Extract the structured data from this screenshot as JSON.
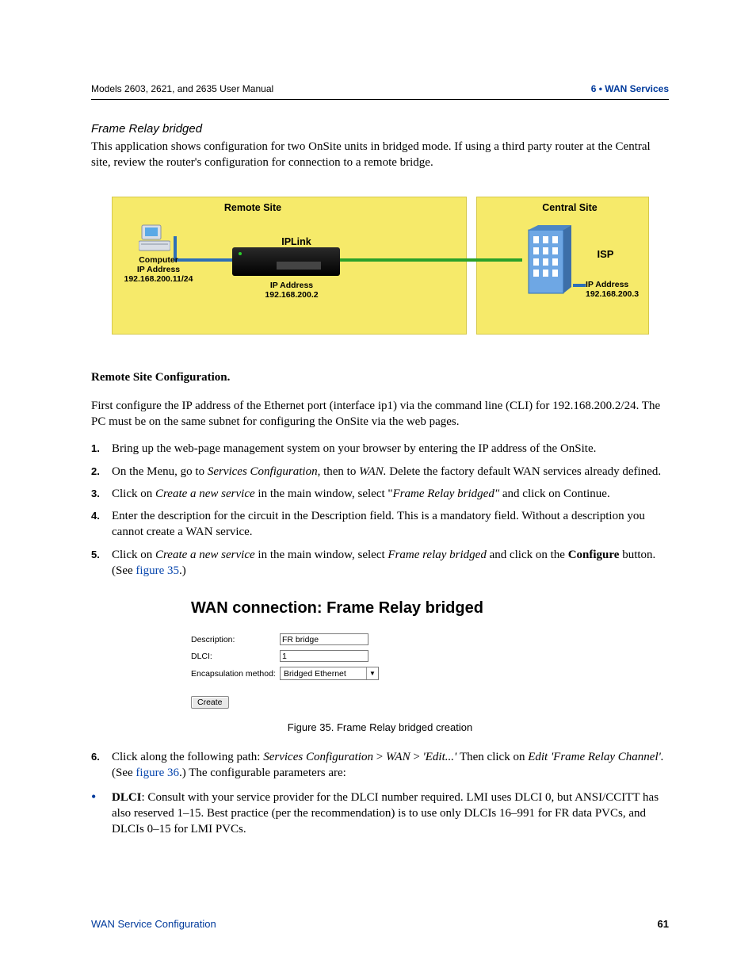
{
  "header": {
    "left": "Models 2603, 2621, and 2635 User Manual",
    "right": "6 • WAN Services"
  },
  "section": {
    "title": "Frame Relay bridged",
    "intro": "This application shows configuration for two OnSite units in bridged mode. If using a third party router at the Central site, review the router's configuration for connection to a remote bridge."
  },
  "diagram": {
    "remote_title": "Remote Site",
    "central_title": "Central Site",
    "iplink": "IPLink",
    "isp": "ISP",
    "computer_label": "Computer\nIP Address\n192.168.200.11/24",
    "iplink_ip": "IP Address\n192.168.200.2",
    "central_ip": "IP Address\n192.168.200.3"
  },
  "remote_config_heading": "Remote Site Configuration.",
  "remote_config_para": "First configure the IP address of the Ethernet port (interface ip1) via the command line (CLI) for 192.168.200.2/24. The PC must be on the same subnet for configuring the OnSite via the web pages.",
  "steps": [
    {
      "num": "1.",
      "text_plain": "Bring up the web-page management system on your browser by entering the IP address of the OnSite."
    },
    {
      "num": "2.",
      "pre": "On the Menu, go to ",
      "i1": "Services Configuration",
      "mid1": ", then to ",
      "i2": "WAN. ",
      "post": "Delete the factory default WAN services already defined."
    },
    {
      "num": "3.",
      "pre": "Click on ",
      "i1": "Create a new service",
      "mid1": " in the main window, select \"",
      "i2": "Frame Relay bridged\" ",
      "post": "and click on Continue."
    },
    {
      "num": "4.",
      "text_plain": "Enter the description for the circuit in the Description field. This is a mandatory field. Without a description you cannot create a WAN service."
    },
    {
      "num": "5.",
      "pre": "Click on ",
      "i1": "Create a new service",
      "mid1": " in the main window, select ",
      "i2": "Frame relay bridged",
      "mid2": " and click on the ",
      "b1": "Configure",
      "post2": " button. (See ",
      "link": "figure 35",
      "post3": ".)"
    }
  ],
  "figure35": {
    "heading": "WAN connection: Frame Relay bridged",
    "rows": {
      "desc_label": "Description:",
      "desc_value": "FR bridge",
      "dlci_label": "DLCI:",
      "dlci_value": "1",
      "encap_label": "Encapsulation method:",
      "encap_value": "Bridged Ethernet"
    },
    "button": "Create",
    "caption": "Figure 35. Frame Relay bridged creation"
  },
  "step6": {
    "num": "6.",
    "pre": "Click along the following path: ",
    "i1": "Services Configuration",
    "mid1": " > ",
    "i2": "WAN",
    "mid2": " > ",
    "i3": "'Edit...' ",
    "mid3": "Then click on ",
    "i4": "Edit 'Frame Relay Channel'. ",
    "post": "(See ",
    "link": "figure 36",
    "post2": ".) The configurable parameters are:"
  },
  "bullet_dlci": {
    "b": "DLCI",
    "text": ": Consult with your service provider for the DLCI number required. LMI uses DLCI 0, but ANSI/CCITT has also reserved 1–15. Best practice (per the recommendation) is to use only DLCIs 16–991 for FR data PVCs, and DLCIs 0–15 for LMI PVCs."
  },
  "footer": {
    "left": "WAN Service Configuration",
    "page": "61"
  }
}
